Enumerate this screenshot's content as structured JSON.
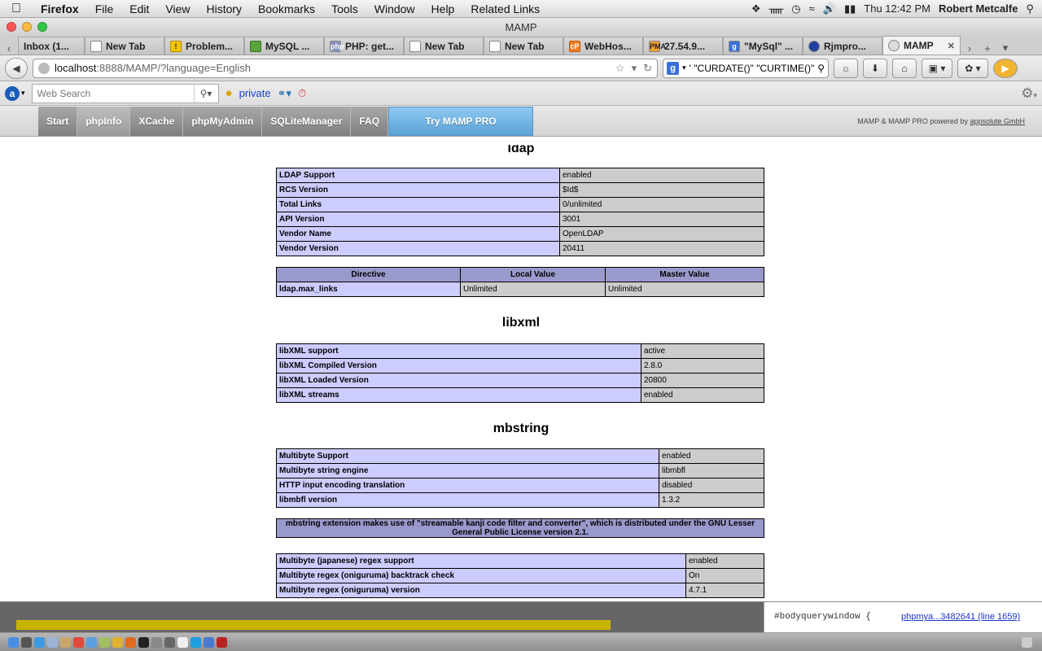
{
  "menubar": {
    "app": "Firefox",
    "items": [
      "File",
      "Edit",
      "View",
      "History",
      "Bookmarks",
      "Tools",
      "Window",
      "Help",
      "Related Links"
    ],
    "clock": "Thu 12:42 PM",
    "user": "Robert Metcalfe"
  },
  "window": {
    "title": "MAMP"
  },
  "tabs": [
    {
      "label": "Inbox (1..."
    },
    {
      "label": "New Tab"
    },
    {
      "label": "Problem..."
    },
    {
      "label": "MySQL ..."
    },
    {
      "label": "PHP: get..."
    },
    {
      "label": "New Tab"
    },
    {
      "label": "New Tab"
    },
    {
      "label": "WebHos..."
    },
    {
      "label": "27.54.9..."
    },
    {
      "label": "\"MySql\" ..."
    },
    {
      "label": "Rjmpro..."
    },
    {
      "label": "MAMP",
      "active": true
    }
  ],
  "urlbar": {
    "host": "localhost",
    "rest": ":8888/MAMP/?language=English"
  },
  "searchbar": {
    "value": "' \"CURDATE()\" \"CURTIME()\""
  },
  "toolbar2": {
    "websearch_placeholder": "Web Search",
    "private_label": "private"
  },
  "mamp_nav": {
    "tabs": [
      "Start",
      "phpInfo",
      "XCache",
      "phpMyAdmin",
      "SQLiteManager",
      "FAQ"
    ],
    "try_pro": "Try MAMP PRO",
    "powered_prefix": "MAMP & MAMP PRO powered by ",
    "powered_link": "appsolute GmbH"
  },
  "sections": {
    "ldap": {
      "title": "ldap",
      "rows": [
        [
          "LDAP Support",
          "enabled"
        ],
        [
          "RCS Version",
          "$Id$"
        ],
        [
          "Total Links",
          "0/unlimited"
        ],
        [
          "API Version",
          "3001"
        ],
        [
          "Vendor Name",
          "OpenLDAP"
        ],
        [
          "Vendor Version",
          "20411"
        ]
      ],
      "directive_headers": [
        "Directive",
        "Local Value",
        "Master Value"
      ],
      "directives": [
        [
          "ldap.max_links",
          "Unlimited",
          "Unlimited"
        ]
      ]
    },
    "libxml": {
      "title": "libxml",
      "rows": [
        [
          "libXML support",
          "active"
        ],
        [
          "libXML Compiled Version",
          "2.8.0"
        ],
        [
          "libXML Loaded Version",
          "20800"
        ],
        [
          "libXML streams",
          "enabled"
        ]
      ]
    },
    "mbstring": {
      "title": "mbstring",
      "rows": [
        [
          "Multibyte Support",
          "enabled"
        ],
        [
          "Multibyte string engine",
          "libmbfl"
        ],
        [
          "HTTP input encoding translation",
          "disabled"
        ],
        [
          "libmbfl version",
          "1.3.2"
        ]
      ],
      "note": "mbstring extension makes use of \"streamable kanji code filter and converter\", which is distributed under the GNU Lesser General Public License version 2.1.",
      "regex_rows": [
        [
          "Multibyte (japanese) regex support",
          "enabled"
        ],
        [
          "Multibyte regex (oniguruma) backtrack check",
          "On"
        ],
        [
          "Multibyte regex (oniguruma) version",
          "4.7.1"
        ]
      ]
    }
  },
  "behind": {
    "code": "#bodyquerywindow {",
    "link": "phpmya...3482641 (line 1659)"
  }
}
